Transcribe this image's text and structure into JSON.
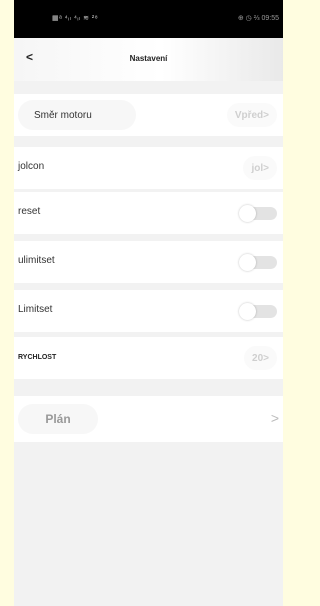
{
  "status_bar": {
    "left_icons": "▦ᵃ ⁴ᵢₗ ⁴ᵢₗ ≋ ²⁸",
    "right": "⊕ ◷ ⅔ 09:55"
  },
  "header": {
    "back_label": "<",
    "title": "Nastavení"
  },
  "rows": [
    {
      "label": "Směr motoru",
      "value": "Vpřed>"
    },
    {
      "label": "jolcon",
      "value": "jol>"
    },
    {
      "label": "reset",
      "toggle_on": false
    },
    {
      "label": "ulimitset",
      "toggle_on": false
    },
    {
      "label": "Limitset",
      "toggle_on": false
    },
    {
      "label": "RYCHLOST",
      "value": "20>"
    }
  ],
  "plan": {
    "label": "Plán",
    "chevron": ">"
  },
  "colors": {
    "page_bg": "#fffde0",
    "screen_bg": "#f2f2f2",
    "row_bg": "#ffffff",
    "toggle_off": "#e3e3e3"
  }
}
